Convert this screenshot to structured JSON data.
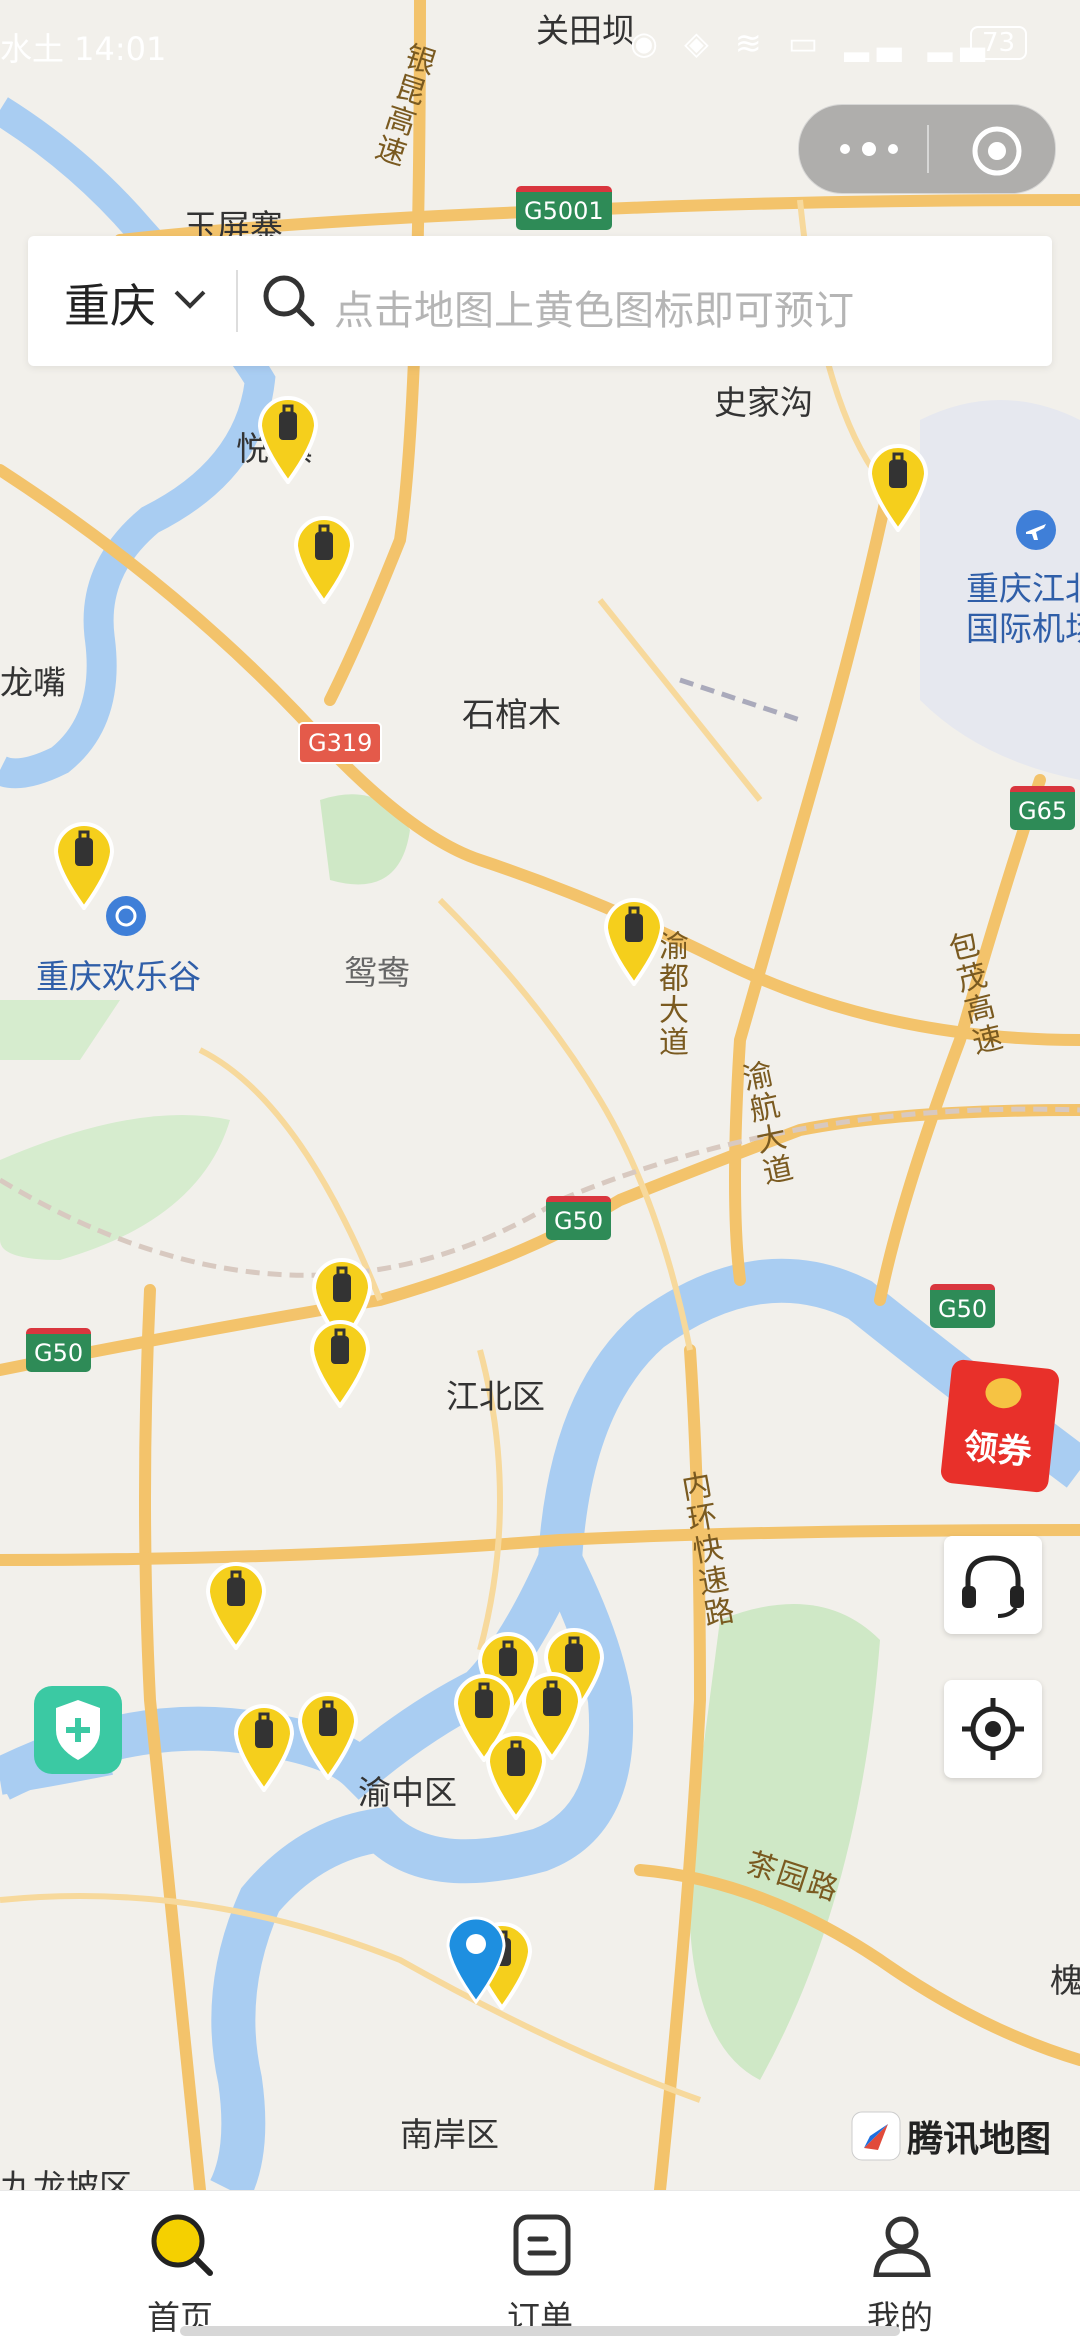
{
  "status_bar": {
    "left_text": "水土 14:01",
    "battery": "73"
  },
  "search": {
    "city": "重庆",
    "placeholder": "点击地图上黄色图标即可预订"
  },
  "map": {
    "places": {
      "guantianba": "关田坝",
      "yupingzhai": "玉屏寨",
      "yuezhen": "悦  镇",
      "shijiagou": "史家沟",
      "airport_line1": "重庆江北",
      "airport_line2": "国际机场",
      "longzui": "龙嘴",
      "shiguanmu": "石棺木",
      "huanlegu": "重庆欢乐谷",
      "yuanyang": "鸳鸯",
      "jiangbei": "江北区",
      "yuzhong": "渝中区",
      "nanan": "南岸区",
      "jiulongpo": "九龙坡区",
      "huai": "槐"
    },
    "roads": {
      "yinkun": "银昆高速",
      "yudu": "渝都大道",
      "yuhang": "渝航大道",
      "baomao": "包茂高速",
      "neihuan": "内环快速路",
      "chayuan": "茶园路"
    },
    "shields": {
      "g5001": "G5001",
      "g319": "G319",
      "g65": "G65",
      "g50_center": "G50",
      "g50_left": "G50",
      "g50_right": "G50"
    },
    "provider": "腾讯地图",
    "coupon": "领券"
  },
  "tabs": [
    {
      "label": "首页",
      "icon": "home-search-icon"
    },
    {
      "label": "订单",
      "icon": "order-icon"
    },
    {
      "label": "我的",
      "icon": "profile-icon"
    }
  ],
  "colors": {
    "pin_yellow": "#f5cf1c",
    "accent": "#f5d000",
    "river": "#a9cdf2"
  }
}
